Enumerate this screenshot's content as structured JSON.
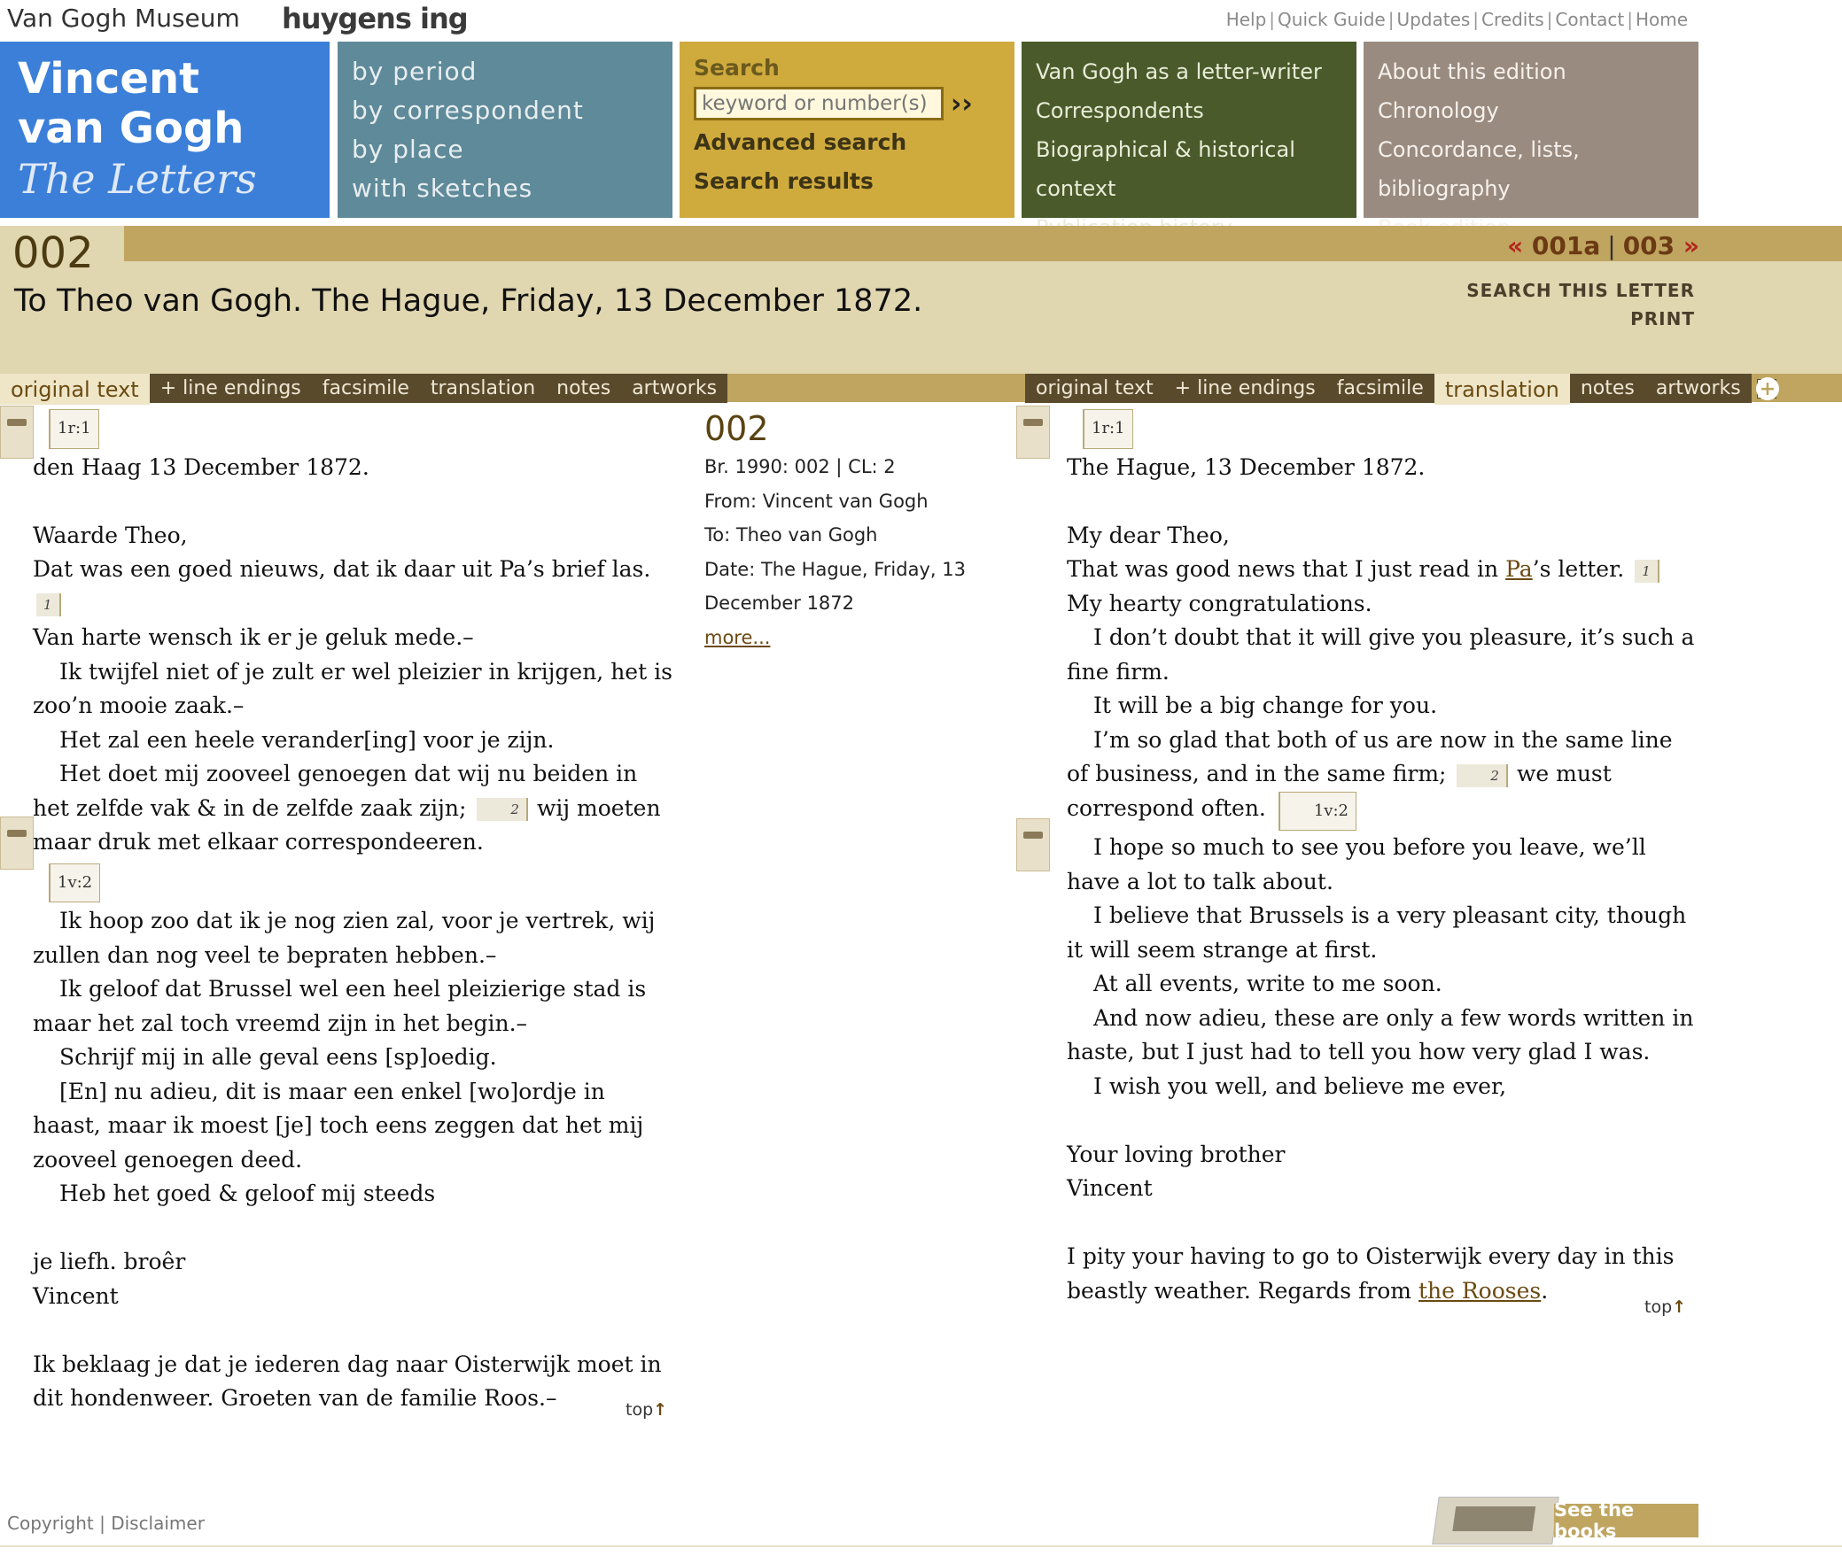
{
  "header": {
    "museum_logo": "Van Gogh Museum",
    "partner_logo": "huygens ing",
    "links": [
      "Help",
      "Quick Guide",
      "Updates",
      "Credits",
      "Contact",
      "Home"
    ]
  },
  "nav": {
    "title_line1": "Vincent",
    "title_line2": "van Gogh",
    "title_line3": "The Letters",
    "browse": [
      "by period",
      "by correspondent",
      "by place",
      "with sketches"
    ],
    "search_label": "Search",
    "search_placeholder": "keyword or number(s)",
    "search_go": "››",
    "search_links": [
      "Advanced search",
      "Search results"
    ],
    "letter_writer": [
      "Van Gogh as a letter-writer",
      "Correspondents",
      "Biographical & historical context",
      "Publication history"
    ],
    "about": [
      "About this edition",
      "Chronology",
      "Concordance, lists, bibliography",
      "Book edition"
    ]
  },
  "letter": {
    "number": "002",
    "prev": "001a",
    "next": "003",
    "prev_arrow": "«",
    "next_arrow": "»",
    "separator": "|",
    "title": "To Theo van Gogh. The Hague, Friday, 13 December 1872.",
    "search_this": "SEARCH THIS LETTER",
    "print": "PRINT"
  },
  "tabs_left": {
    "items": [
      "original text",
      "+ line endings",
      "facsimile",
      "translation",
      "notes",
      "artworks"
    ],
    "active": "original text"
  },
  "tabs_right": {
    "items": [
      "original text",
      "+ line endings",
      "facsimile",
      "translation",
      "notes",
      "artworks"
    ],
    "active": "translation",
    "close": "✕",
    "add": "+"
  },
  "original": {
    "page1": "1r:1",
    "page2": "1v:2",
    "lines": {
      "l1": "den Haag 13 December 1872.",
      "l2": "Waarde Theo,",
      "l3a": "Dat was een goed nieuws, dat ik daar uit Pa’s brief las.",
      "fn1": "1",
      "l4": "Van harte wensch ik er je geluk mede.–",
      "l5": "Ik twijfel niet of je zult er wel pleizier in krijgen, het is zoo’n mooie zaak.–",
      "l6": "Het zal een heele verander[ing] voor je zijn.",
      "l7a": "Het doet mij zooveel genoegen dat wij nu beiden in het zelfde vak & in de zelfde zaak zijn;",
      "fn2": "2",
      "l7b": "wij moeten maar druk met elkaar correspondeeren.",
      "l8": "Ik hoop zoo dat ik je nog zien zal, voor je vertrek, wij zullen dan nog veel te bepraten hebben.–",
      "l9": "Ik geloof dat Brussel wel een heel pleizierige stad is maar het zal toch vreemd zijn in het begin.–",
      "l10": "Schrijf mij in alle geval eens [sp]oedig.",
      "l11": "[En] nu adieu, dit is maar een enkel [wo]ordje in haast, maar ik moest [je] toch eens zeggen dat het mij zooveel genoegen deed.",
      "l12": "Heb het goed & geloof mij steeds",
      "l13": "je liefh. broêr",
      "l14": "Vincent",
      "l15": "Ik beklaag je dat je iederen dag naar Oisterwijk moet in dit hondenweer. Groeten van de familie Roos.–"
    },
    "top": "top"
  },
  "meta": {
    "number": "002",
    "br": "Br. 1990: 002 | CL: 2",
    "from": "From: Vincent van Gogh",
    "to": "To: Theo van Gogh",
    "date": "Date: The Hague, Friday, 13 December 1872",
    "more": "more..."
  },
  "translation": {
    "page1": "1r:1",
    "page2": "1v:2",
    "lines": {
      "l1": "The Hague, 13 December 1872.",
      "l2": "My dear Theo,",
      "l3a": "That was good news that I just read in",
      "pa": "Pa",
      "l3b": "’s letter.",
      "fn1": "1",
      "l3c": "My hearty congratulations.",
      "l4": "I don’t doubt that it will give you pleasure, it’s such a fine firm.",
      "l5": "It will be a big change for you.",
      "l6a": "I’m so glad that both of us are now in the same line of business, and in the same firm;",
      "fn2": "2",
      "l6b": "we must correspond often.",
      "l7": "I hope so much to see you before you leave, we’ll have a lot to talk about.",
      "l8": "I believe that Brussels is a very pleasant city, though it will seem strange at first.",
      "l9": "At all events, write to me soon.",
      "l10": "And now adieu, these are only a few words written in haste, but I just had to tell you how very glad I was.",
      "l11": "I wish you well, and believe me ever,",
      "l12": "Your loving brother",
      "l13": "Vincent",
      "l14a": "I pity your having to go to Oisterwijk every day in this beastly weather. Regards from",
      "rooses": "the Rooses",
      "l14b": "."
    },
    "top": "top"
  },
  "footer": {
    "copyright": "Copyright",
    "disclaimer": "Disclaimer",
    "books": "See the books"
  },
  "colors": {
    "title_block": "#3b7fd8",
    "browse_block": "#5f8a9a",
    "search_block": "#cfaa3d",
    "letter_block": "#4a5a2a",
    "about_block": "#9a8b80",
    "header_band": "#e0d6b0",
    "accent_bar": "#bfa560",
    "tab_dark": "#5a4a2c"
  }
}
